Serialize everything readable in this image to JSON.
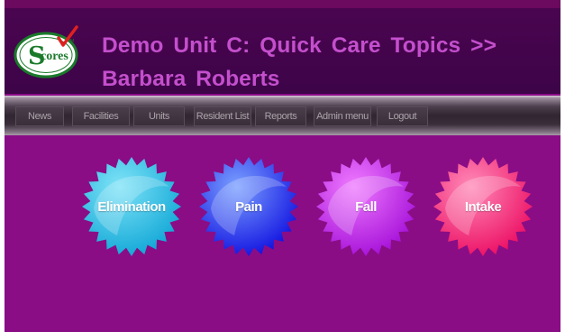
{
  "header": {
    "title": "Demo  Unit C: Quick Care Topics  >>  Barbara Roberts",
    "logo": {
      "text": "Scores",
      "tm": "TM",
      "colors": {
        "ring": "#1a7a2a",
        "text": "#1a7a2a",
        "check": "#e02020"
      }
    }
  },
  "nav": {
    "items": [
      {
        "label": "News"
      },
      {
        "label": "Facilities"
      },
      {
        "label": "Units"
      },
      {
        "label": "Resident List"
      },
      {
        "label": "Reports"
      },
      {
        "label": "Admin menu"
      },
      {
        "label": "Logout"
      }
    ]
  },
  "topics": [
    {
      "label": "Elimination",
      "icon": "starburst-badge-icon",
      "colors": {
        "light": "#7fe3f7",
        "dark": "#0fa6d6"
      }
    },
    {
      "label": "Pain",
      "icon": "starburst-badge-icon",
      "colors": {
        "light": "#7aa0ff",
        "dark": "#1010e0"
      }
    },
    {
      "label": "Fall",
      "icon": "starburst-badge-icon",
      "colors": {
        "light": "#ef7aff",
        "dark": "#a40fd8"
      }
    },
    {
      "label": "Intake",
      "icon": "starburst-badge-icon",
      "colors": {
        "light": "#ff8ab8",
        "dark": "#ec0d62"
      }
    }
  ],
  "colors": {
    "page_bg": "#8a0d86",
    "header_bg": "#3d0448",
    "title": "#c44fcd",
    "nav_text": "#a9a3a9"
  }
}
